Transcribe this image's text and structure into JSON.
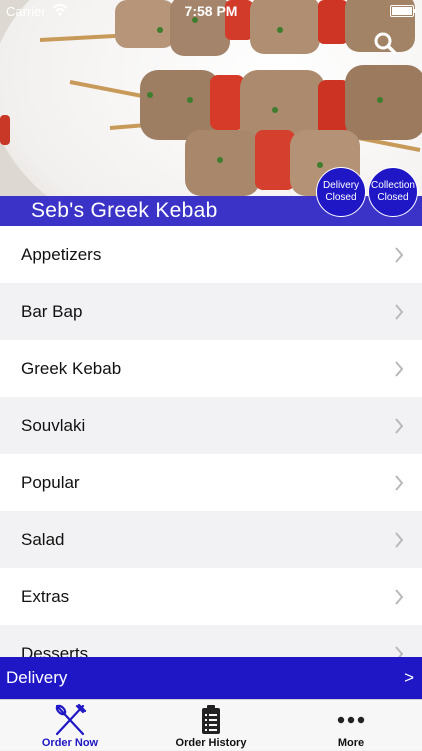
{
  "status_bar": {
    "carrier": "Carrier",
    "time": "7:58 PM",
    "icons": [
      "wifi-icon",
      "battery-icon"
    ]
  },
  "header": {
    "restaurant_name": "Seb's Greek Kebab",
    "search_icon": "search-icon",
    "badges": {
      "delivery": {
        "line1": "Delivery",
        "line2": "Closed"
      },
      "collection": {
        "line1": "Collection",
        "line2": "Closed"
      }
    }
  },
  "menu": {
    "items": [
      {
        "label": "Appetizers"
      },
      {
        "label": "Bar Bap"
      },
      {
        "label": "Greek Kebab"
      },
      {
        "label": "Souvlaki"
      },
      {
        "label": "Popular"
      },
      {
        "label": "Salad"
      },
      {
        "label": "Extras"
      },
      {
        "label": "Desserts"
      }
    ],
    "chevron_icon": "chevron-right-icon"
  },
  "delivery_bar": {
    "label": "Delivery",
    "arrow": ">"
  },
  "tab_bar": {
    "tabs": [
      {
        "label": "Order Now",
        "icon": "fork-knife-icon",
        "active": true
      },
      {
        "label": "Order History",
        "icon": "receipt-icon",
        "active": false
      },
      {
        "label": "More",
        "icon": "more-dots-icon",
        "active": false
      }
    ]
  },
  "colors": {
    "accent": "#1f17c6",
    "title_bar": "#3b33c8",
    "row_alt": "#f2f2f4",
    "row": "#ffffff"
  }
}
